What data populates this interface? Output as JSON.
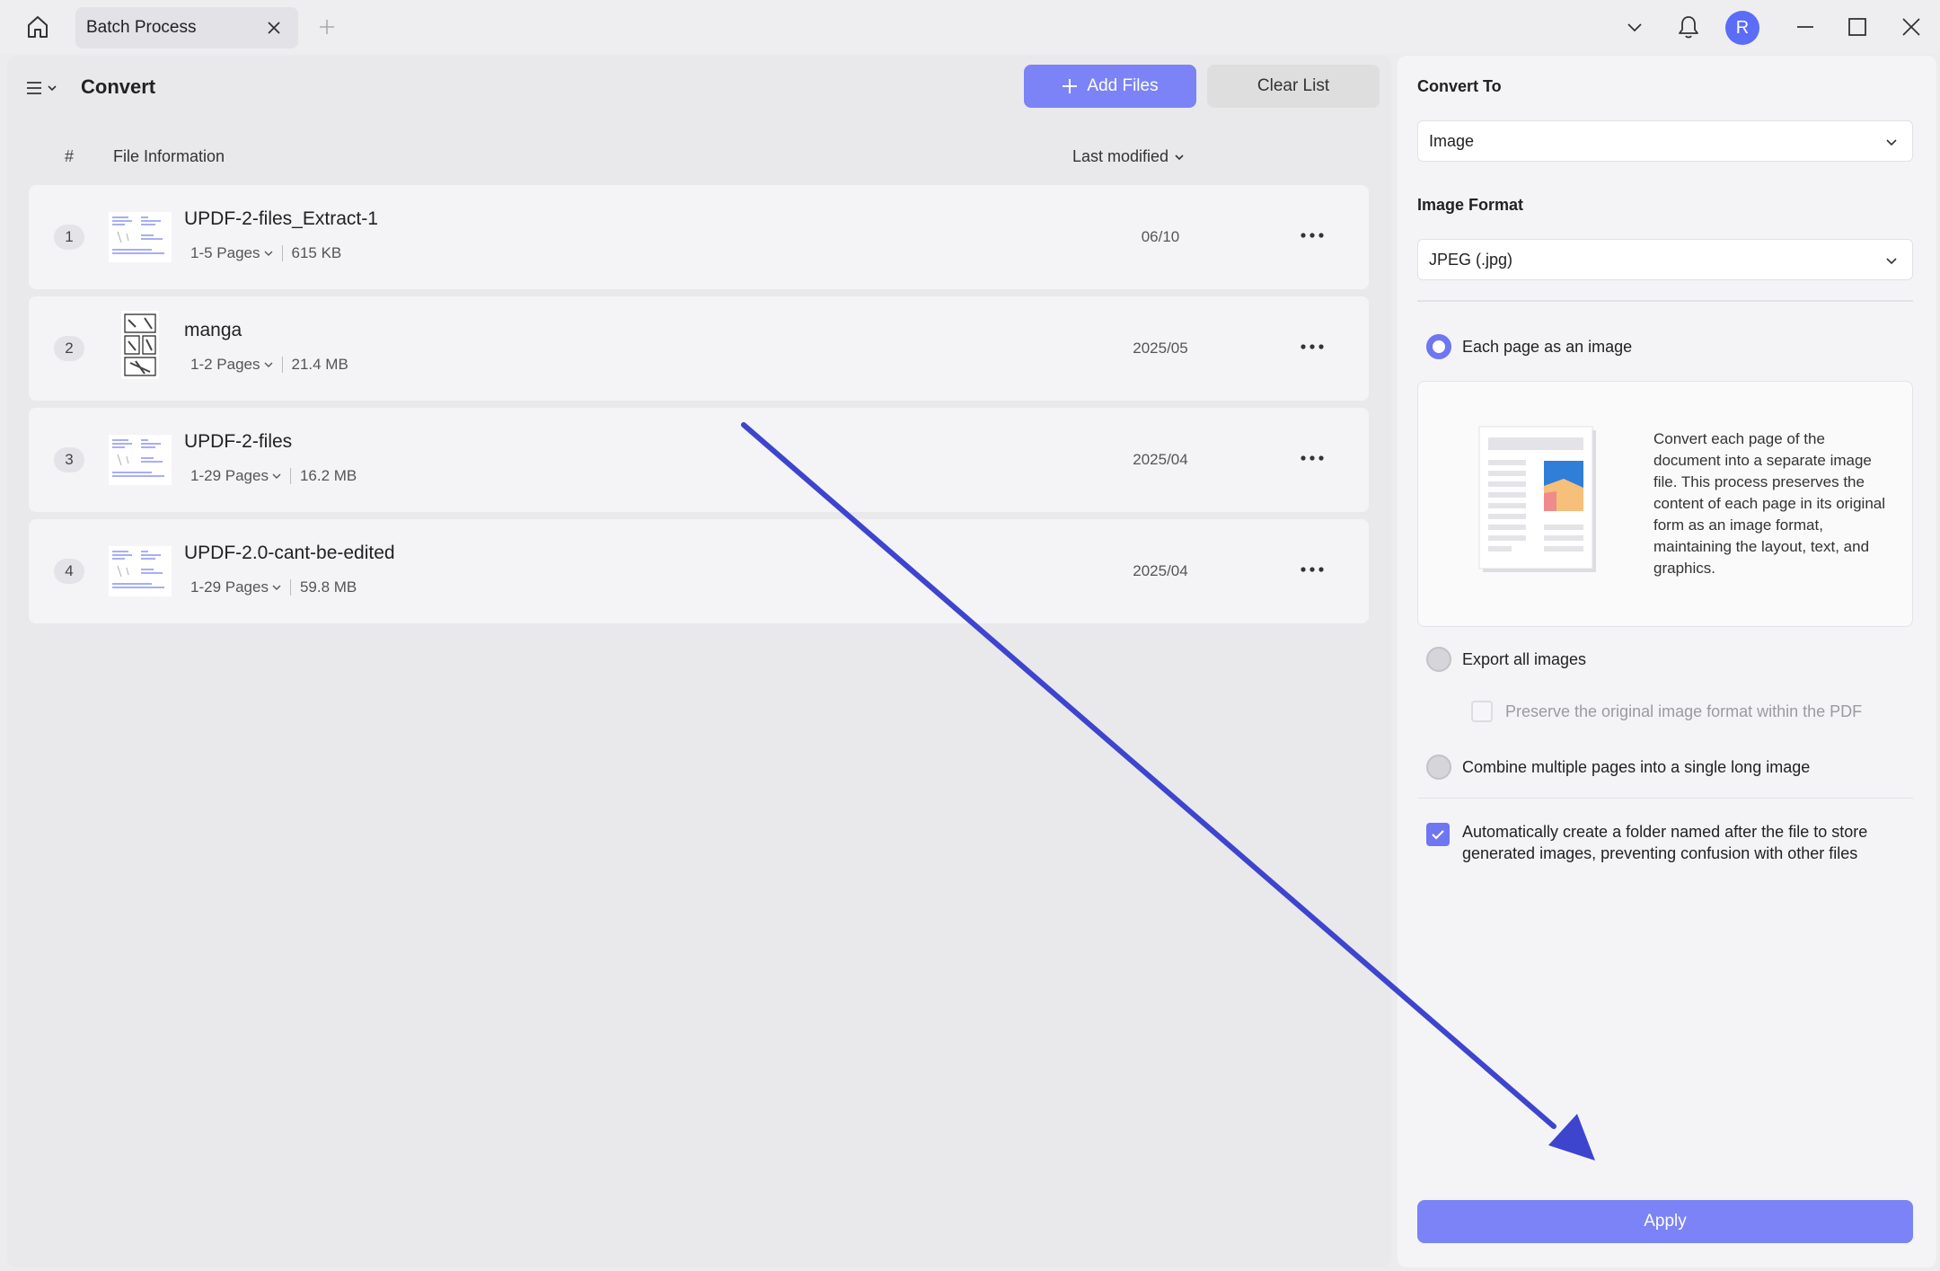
{
  "titlebar": {
    "tab_label": "Batch Process",
    "avatar_initial": "R"
  },
  "convert_panel": {
    "title": "Convert",
    "add_files_label": "Add Files",
    "clear_list_label": "Clear List",
    "columns": {
      "number": "#",
      "file_info": "File Information",
      "last_modified": "Last modified"
    },
    "files": [
      {
        "index": "1",
        "name": "UPDF-2-files_Extract-1",
        "pages": "1-5 Pages",
        "size": "615 KB",
        "modified": "06/10"
      },
      {
        "index": "2",
        "name": "manga",
        "pages": "1-2 Pages",
        "size": "21.4 MB",
        "modified": "2025/05"
      },
      {
        "index": "3",
        "name": "UPDF-2-files",
        "pages": "1-29 Pages",
        "size": "16.2 MB",
        "modified": "2025/04"
      },
      {
        "index": "4",
        "name": "UPDF-2.0-cant-be-edited",
        "pages": "1-29 Pages",
        "size": "59.8 MB",
        "modified": "2025/04"
      }
    ]
  },
  "settings": {
    "convert_to_label": "Convert To",
    "convert_to_value": "Image",
    "image_format_label": "Image Format",
    "image_format_value": "JPEG (.jpg)",
    "option_each_page": "Each page as an image",
    "option_each_page_description": "Convert each page of the document into a separate image file. This process preserves the content of each page in its original form as an image format, maintaining the layout, text, and graphics.",
    "option_export_all": "Export all images",
    "preserve_format": "Preserve the original image format within the PDF",
    "option_combine": "Combine multiple pages into a single long image",
    "auto_folder": "Automatically create a folder named after the file to store generated images, preventing confusion with other files",
    "apply_label": "Apply"
  },
  "colors": {
    "accent": "#7b83f6",
    "annotation_arrow": "#3d45cf"
  }
}
